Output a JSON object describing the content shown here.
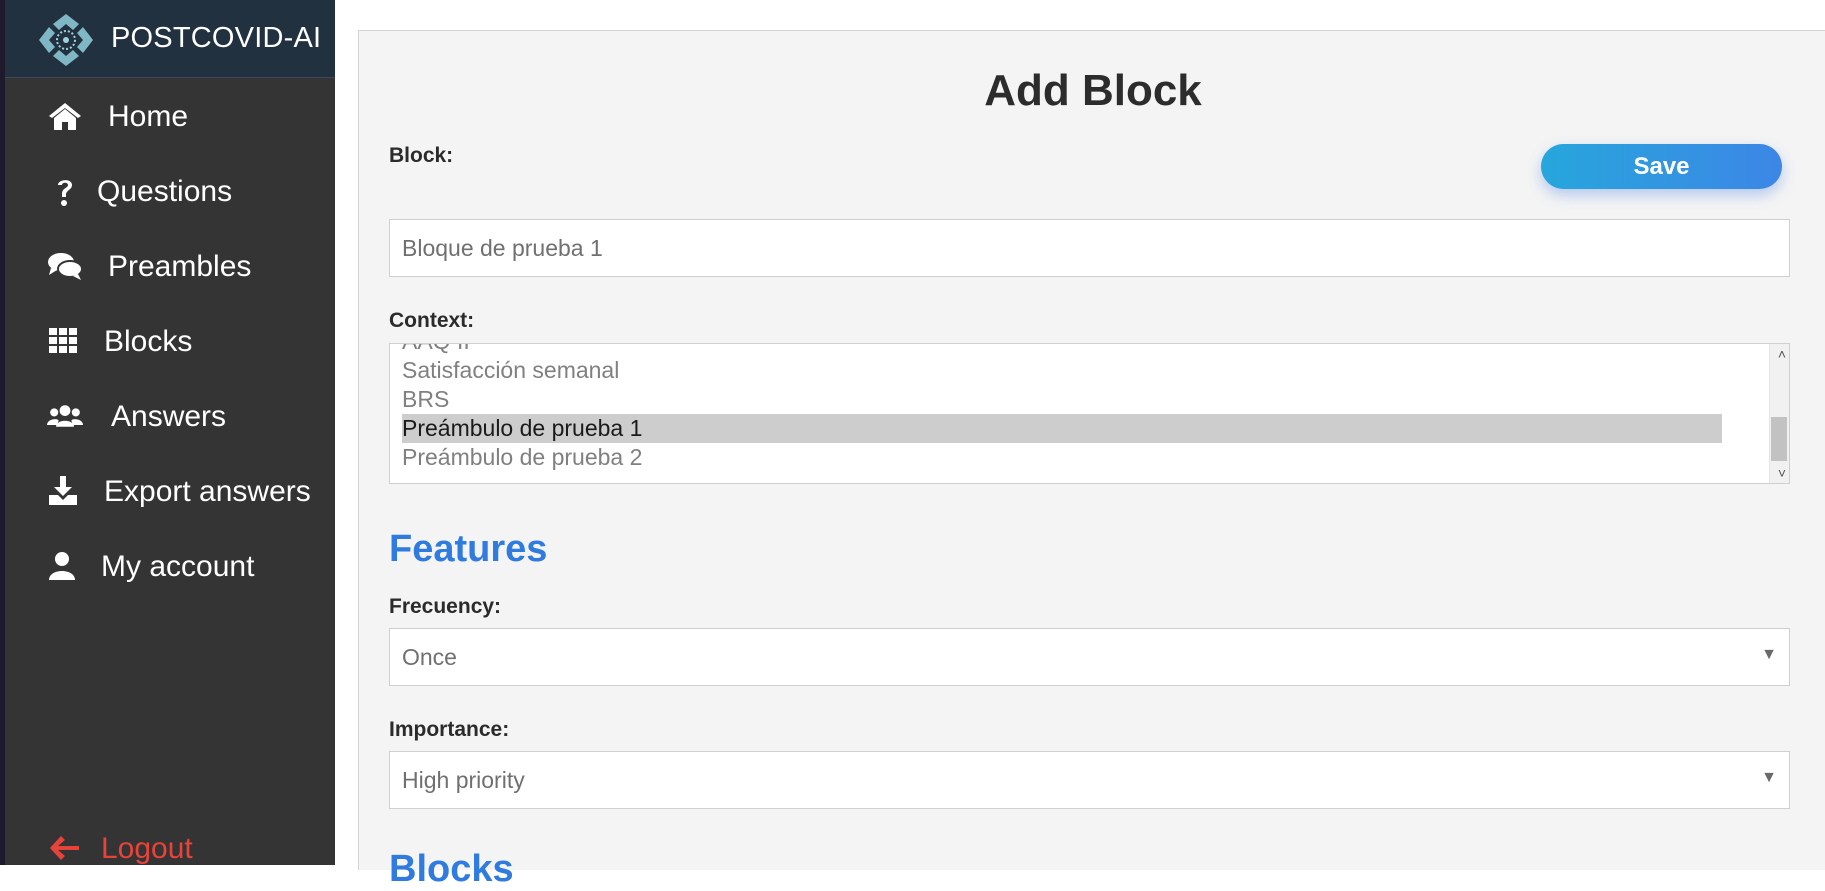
{
  "app": {
    "brand_name": "POSTCOVID-AI"
  },
  "sidebar": {
    "items": [
      {
        "label": "Home",
        "icon": "home-icon"
      },
      {
        "label": "Questions",
        "icon": "question-mark-icon"
      },
      {
        "label": "Preambles",
        "icon": "chat-bubbles-icon"
      },
      {
        "label": "Blocks",
        "icon": "grid-icon"
      },
      {
        "label": "Answers",
        "icon": "users-icon"
      },
      {
        "label": "Export answers",
        "icon": "download-icon"
      },
      {
        "label": "My account",
        "icon": "user-icon"
      }
    ],
    "logout_label": "Logout"
  },
  "form": {
    "title": "Add Block",
    "block_label": "Block:",
    "save_label": "Save",
    "block_value": "Bloque de prueba 1",
    "context_label": "Context:",
    "context_options": [
      "AAQ II",
      "Satisfacción semanal",
      "BRS",
      "Preámbulo de prueba 1",
      "Preámbulo de prueba 2"
    ],
    "context_selected": "Preámbulo de prueba 1",
    "features_title": "Features",
    "frequency_label": "Frecuency:",
    "frequency_value": "Once",
    "importance_label": "Importance:",
    "importance_value": "High priority",
    "next_section_title": "Blocks"
  },
  "colors": {
    "sidebar_bg": "#343434",
    "brand_bg": "#223140",
    "accent_blue": "#2f7be0",
    "logout_red": "#e8433a",
    "save_gradient_start": "#27a6dc",
    "save_gradient_end": "#3d86e6"
  }
}
